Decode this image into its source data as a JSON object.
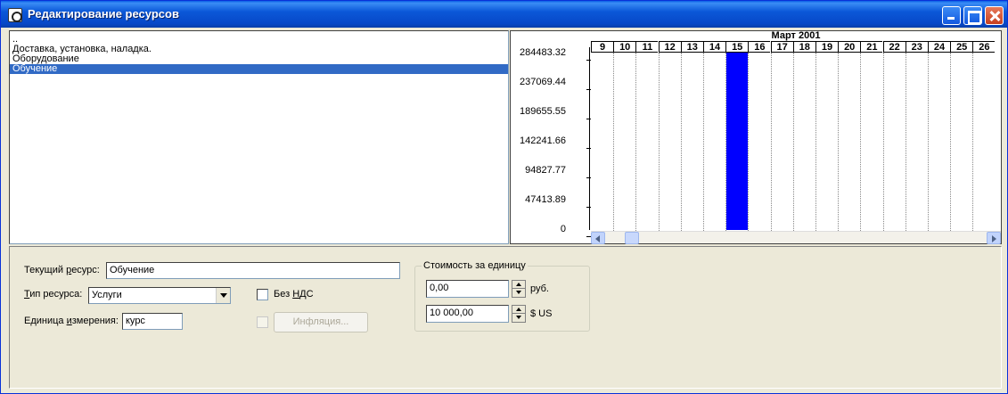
{
  "window": {
    "title": "Редактирование ресурсов"
  },
  "resource_list": {
    "items": [
      {
        "label": "..",
        "selected": false
      },
      {
        "label": "Доставка, установка, наладка.",
        "selected": false
      },
      {
        "label": "Оборудование",
        "selected": false
      },
      {
        "label": "Обучение",
        "selected": true
      }
    ]
  },
  "chart_data": {
    "type": "bar",
    "month_label": "Март 2001",
    "categories": [
      "9",
      "10",
      "11",
      "12",
      "13",
      "14",
      "15",
      "16",
      "17",
      "18",
      "19",
      "20",
      "21",
      "22",
      "23",
      "24",
      "25",
      "26"
    ],
    "values": [
      0,
      0,
      0,
      0,
      0,
      0,
      275000,
      0,
      0,
      0,
      0,
      0,
      0,
      0,
      0,
      0,
      0,
      0
    ],
    "y_ticks": [
      "284483.32",
      "237069.44",
      "189655.55",
      "142241.66",
      "94827.77",
      "47413.89",
      "0"
    ],
    "ylim": [
      0,
      284483.32
    ],
    "bar_color": "#0000FF",
    "grid": true
  },
  "form": {
    "current_resource_label_pre": "Текущий ",
    "current_resource_label_u": "р",
    "current_resource_label_post": "есурс:",
    "current_resource_value": "Обучение",
    "resource_type_label_u": "Т",
    "resource_type_label_post": "ип ресурса:",
    "resource_type_value": "Услуги",
    "unit_label_pre": "Единица ",
    "unit_label_u": "и",
    "unit_label_post": "змерения:",
    "unit_value": "курс",
    "no_vat_label_pre": "Без ",
    "no_vat_label_u": "Н",
    "no_vat_label_post": "ДС",
    "inflation_button": "Инфляция...",
    "cost_group_title": "Стоимость за единицу",
    "cost_rub_value": "0,00",
    "cost_rub_unit": "руб.",
    "cost_usd_value": "10 000,00",
    "cost_usd_unit": "$ US"
  }
}
